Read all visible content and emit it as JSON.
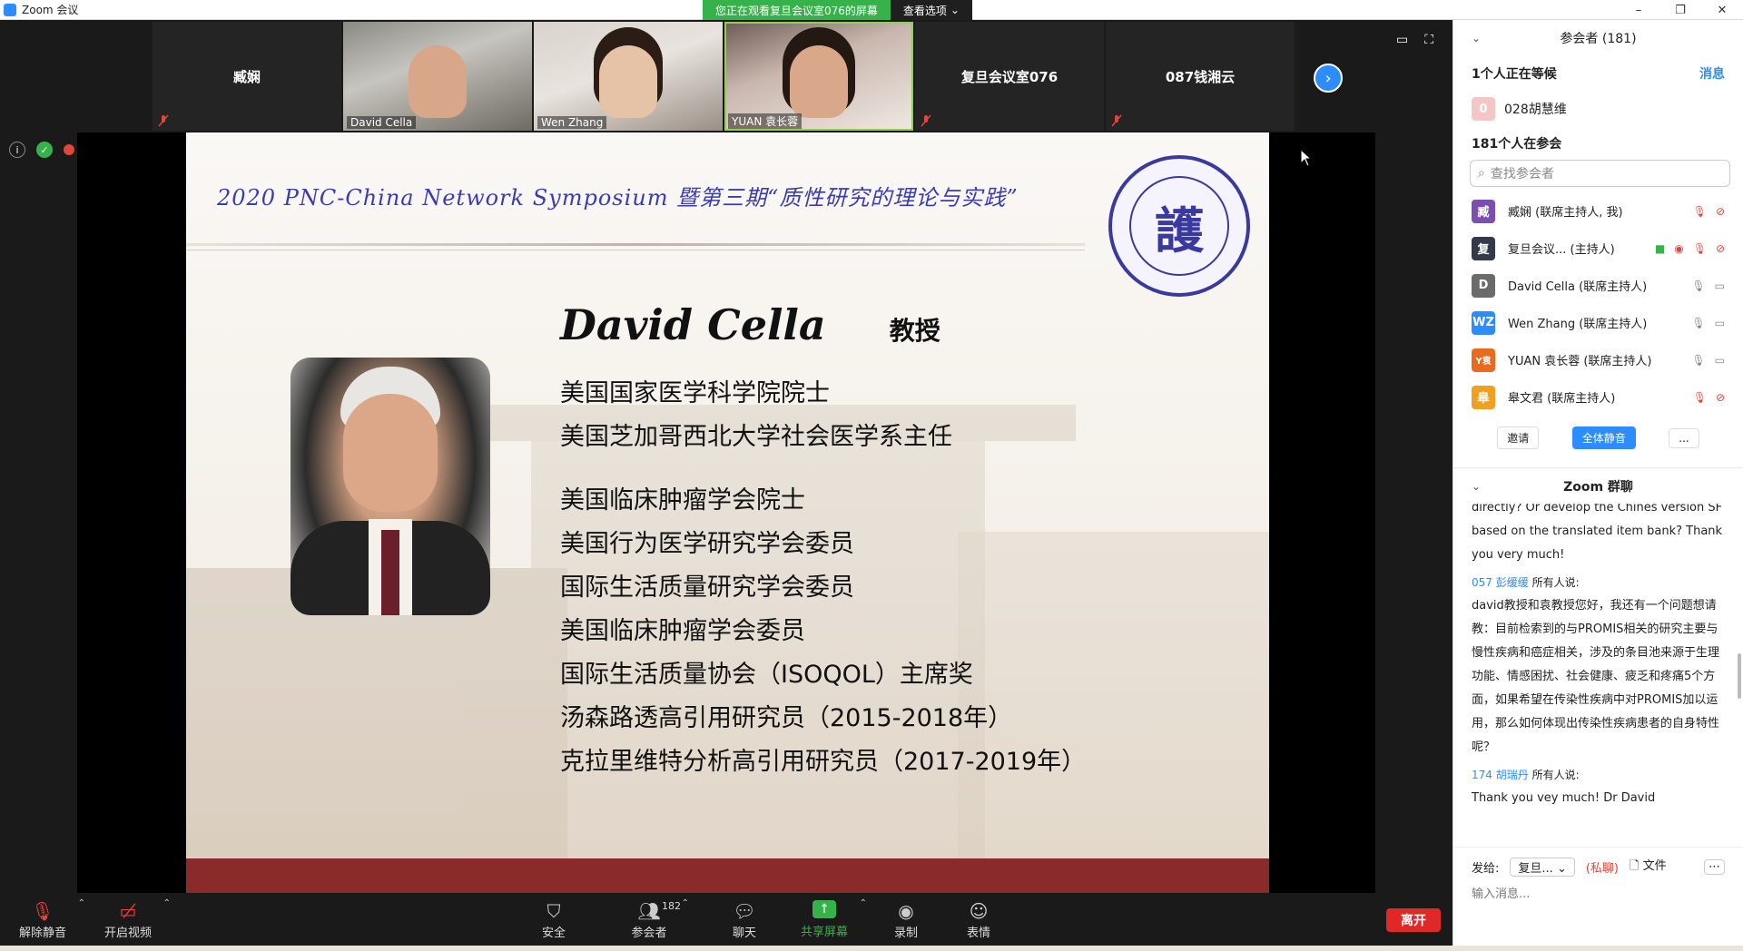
{
  "window": {
    "title": "Zoom 会议",
    "controls": [
      "–",
      "❐",
      "✕"
    ]
  },
  "banner": {
    "message": "您正在观看复旦会议室076的屏幕",
    "options": "查看选项"
  },
  "gallery": [
    {
      "name": "臧娴",
      "video": false
    },
    {
      "name": "David Cella",
      "video": true
    },
    {
      "name": "Wen Zhang",
      "video": true
    },
    {
      "name": "YUAN 袁长蓉",
      "video": true
    },
    {
      "name": "复旦会议室076",
      "video": false
    },
    {
      "name": "087钱湘云",
      "video": false
    }
  ],
  "status": {
    "recording": "录制"
  },
  "slide": {
    "header": "2020 PNC-China Network Symposium 暨第三期“质性研究的理论与实践”",
    "seal": "護",
    "speaker": "David Cella",
    "speaker_title": "教授",
    "credentials_a": [
      "美国国家医学科学院院士",
      "美国芝加哥西北大学社会医学系主任"
    ],
    "credentials_b": [
      "美国临床肿瘤学会院士",
      "美国行为医学研究学会委员",
      "国际生活质量研究学会委员",
      "美国临床肿瘤学会委员",
      "国际生活质量协会（ISOQOL）主席奖",
      "汤森路透高引用研究员（2015-2018年）",
      "克拉里维特分析高引用研究员（2017-2019年）"
    ]
  },
  "toolbar": {
    "unmute": "解除静音",
    "start_video": "开启视频",
    "security": "安全",
    "participants": "参会者",
    "participants_count": "182",
    "chat": "聊天",
    "share_screen": "共享屏幕",
    "record": "录制",
    "reactions": "表情",
    "leave": "离开"
  },
  "panel": {
    "title": "参会者 (181)",
    "waiting_label": "1个人正在等候",
    "waiting_action": "消息",
    "waiting_person": {
      "initial": "0",
      "name": "028胡慧维"
    },
    "in_meeting_label": "181个人在参会",
    "search_placeholder": "查找参会者",
    "participants": [
      {
        "initial": "臧",
        "color": "#7b4fb0",
        "name": "臧娴 (联席主持人, 我)"
      },
      {
        "initial": "复",
        "color": "#333a4a",
        "name": "复旦会议...    (主持人)"
      },
      {
        "initial": "D",
        "color": "#6b6b6b",
        "name": "David Cella (联席主持人)"
      },
      {
        "initial": "WZ",
        "color": "#2d8cff",
        "name": "Wen Zhang (联席主持人)"
      },
      {
        "initial": "Y袁",
        "color": "#e86b1f",
        "name": "YUAN 袁长蓉 (联席主持人)"
      },
      {
        "initial": "皋",
        "color": "#f0a020",
        "name": "皋文君 (联席主持人)"
      }
    ],
    "buttons": {
      "invite": "邀请",
      "mute_all": "全体静音",
      "more": "..."
    },
    "chat_title": "Zoom 群聊",
    "chat_messages": [
      {
        "sender": "",
        "to": "",
        "text": "directly? Or develop the Chines version SF based on the translated item bank? Thank you very much!"
      },
      {
        "sender": "057 彭缓缓",
        "to": "所有人说:",
        "text": "david教授和袁教授您好，我还有一个问题想请教：目前检索到的与PROMIS相关的研究主要与慢性疾病和癌症相关，涉及的条目池来源于生理功能、情感困扰、社会健康、疲乏和疼痛5个方面，如果希望在传染性疾病中对PROMIS加以运用，那么如何体现出传染性疾病患者的自身特性呢？"
      },
      {
        "sender": "174 胡瑞丹",
        "to": "所有人说:",
        "text": "Thank you vey much! Dr David"
      }
    ],
    "send_label": "发给:",
    "send_to": "复旦...",
    "private": "(私聊)",
    "file": "文件",
    "input_placeholder": "输入消息..."
  }
}
